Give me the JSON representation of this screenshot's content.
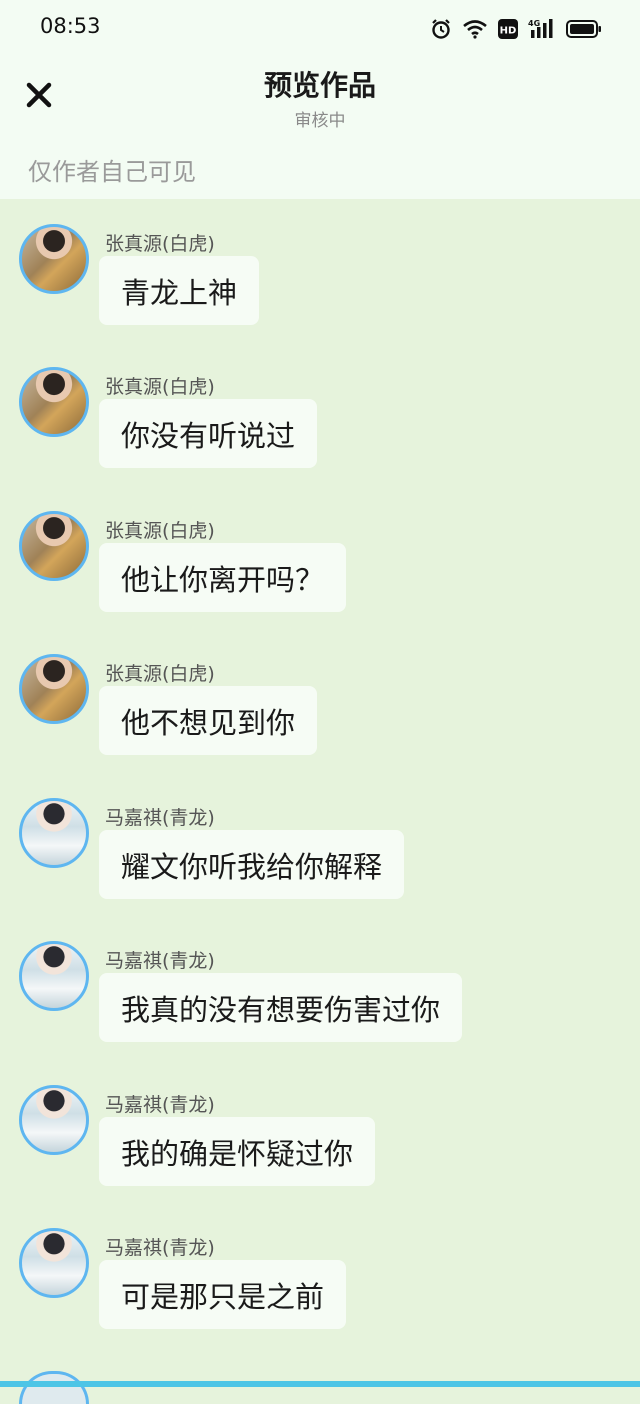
{
  "status_bar": {
    "time": "08:53"
  },
  "header": {
    "title": "预览作品",
    "subtitle": "审核中",
    "notice": "仅作者自己可见"
  },
  "messages": [
    {
      "speaker": "张真源(白虎)",
      "text": "青龙上神",
      "avatar": "tiger"
    },
    {
      "speaker": "张真源(白虎)",
      "text": "你没有听说过",
      "avatar": "tiger"
    },
    {
      "speaker": "张真源(白虎)",
      "text": "他让你离开吗？",
      "avatar": "tiger"
    },
    {
      "speaker": "张真源(白虎)",
      "text": "他不想见到你",
      "avatar": "tiger"
    },
    {
      "speaker": "马嘉祺(青龙)",
      "text": "耀文你听我给你解释",
      "avatar": "dragon"
    },
    {
      "speaker": "马嘉祺(青龙)",
      "text": "我真的没有想要伤害过你",
      "avatar": "dragon"
    },
    {
      "speaker": "马嘉祺(青龙)",
      "text": "我的确是怀疑过你",
      "avatar": "dragon"
    },
    {
      "speaker": "马嘉祺(青龙)",
      "text": "可是那只是之前",
      "avatar": "dragon"
    }
  ],
  "colors": {
    "chat_bg": "#e6f3dc",
    "header_bg": "#f3fcf3",
    "bubble_bg": "#f6fcf5",
    "avatar_ring": "#5eb6f0"
  },
  "icons": [
    "alarm-icon",
    "wifi-icon",
    "hd-icon",
    "signal-4g-icon",
    "battery-icon",
    "close-icon"
  ]
}
